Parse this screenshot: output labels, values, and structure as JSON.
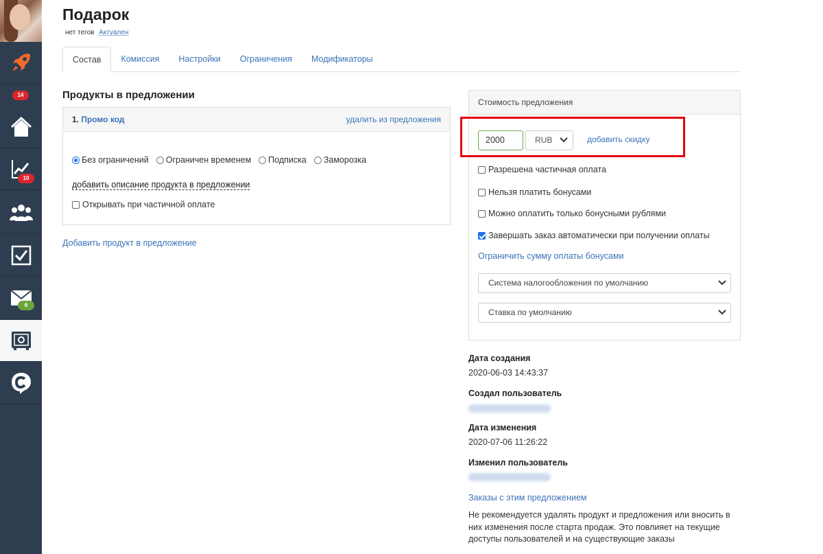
{
  "sidebar": {
    "badges": {
      "rocket_count": "14",
      "analytics_count": "10",
      "mail_count": "6"
    }
  },
  "header": {
    "title": "Подарок",
    "tags_text": "нет тегов",
    "status": "Актуален"
  },
  "tabs": [
    {
      "label": "Состав"
    },
    {
      "label": "Комиссия"
    },
    {
      "label": "Настройки"
    },
    {
      "label": "Ограничения"
    },
    {
      "label": "Модификаторы"
    }
  ],
  "products": {
    "section_title": "Продукты в предложении",
    "item": {
      "number": "1.",
      "name": "Промо код",
      "remove_label": "удалить из предложения",
      "access_options": [
        "Без ограничений",
        "Ограничен временем",
        "Подписка",
        "Заморозка"
      ],
      "description_link": "добавить описание продукта в предложении",
      "open_on_partial": "Открывать при частичной оплате"
    },
    "add_product_link": "Добавить продукт в предложение"
  },
  "price": {
    "panel_title": "Стоимость предложения",
    "amount": "2000",
    "currency": "RUB",
    "add_discount": "добавить скидку",
    "options": [
      {
        "label": "Разрешена частичная оплата",
        "checked": false
      },
      {
        "label": "Нельзя платить бонусами",
        "checked": false
      },
      {
        "label": "Можно оплатить только бонусными рублями",
        "checked": false
      },
      {
        "label": "Завершать заказ автоматически при получении оплаты",
        "checked": true
      }
    ],
    "limit_bonus_link": "Ограничить сумму оплаты бонусами",
    "tax_system": "Система налогообложения по умолчанию",
    "tax_rate": "Ставка по умолчанию"
  },
  "info": {
    "created_label": "Дата создания",
    "created_value": "2020-06-03 14:43:37",
    "created_by_label": "Создал пользователь",
    "modified_label": "Дата изменения",
    "modified_value": "2020-07-06 11:26:22",
    "modified_by_label": "Изменил пользователь",
    "orders_link": "Заказы с этим предложением",
    "warning": "Не рекомендуется удалять продукт и предложения или вносить в них изменения после старта продаж. Это повлияет на текущие доступы пользователей и на существующие заказы"
  },
  "colors": {
    "sidebar_bg": "#2e3e50",
    "link": "#3b73b9",
    "highlight": "#e4000f",
    "badge_red": "#d9272e",
    "badge_green": "#6aa53b"
  }
}
